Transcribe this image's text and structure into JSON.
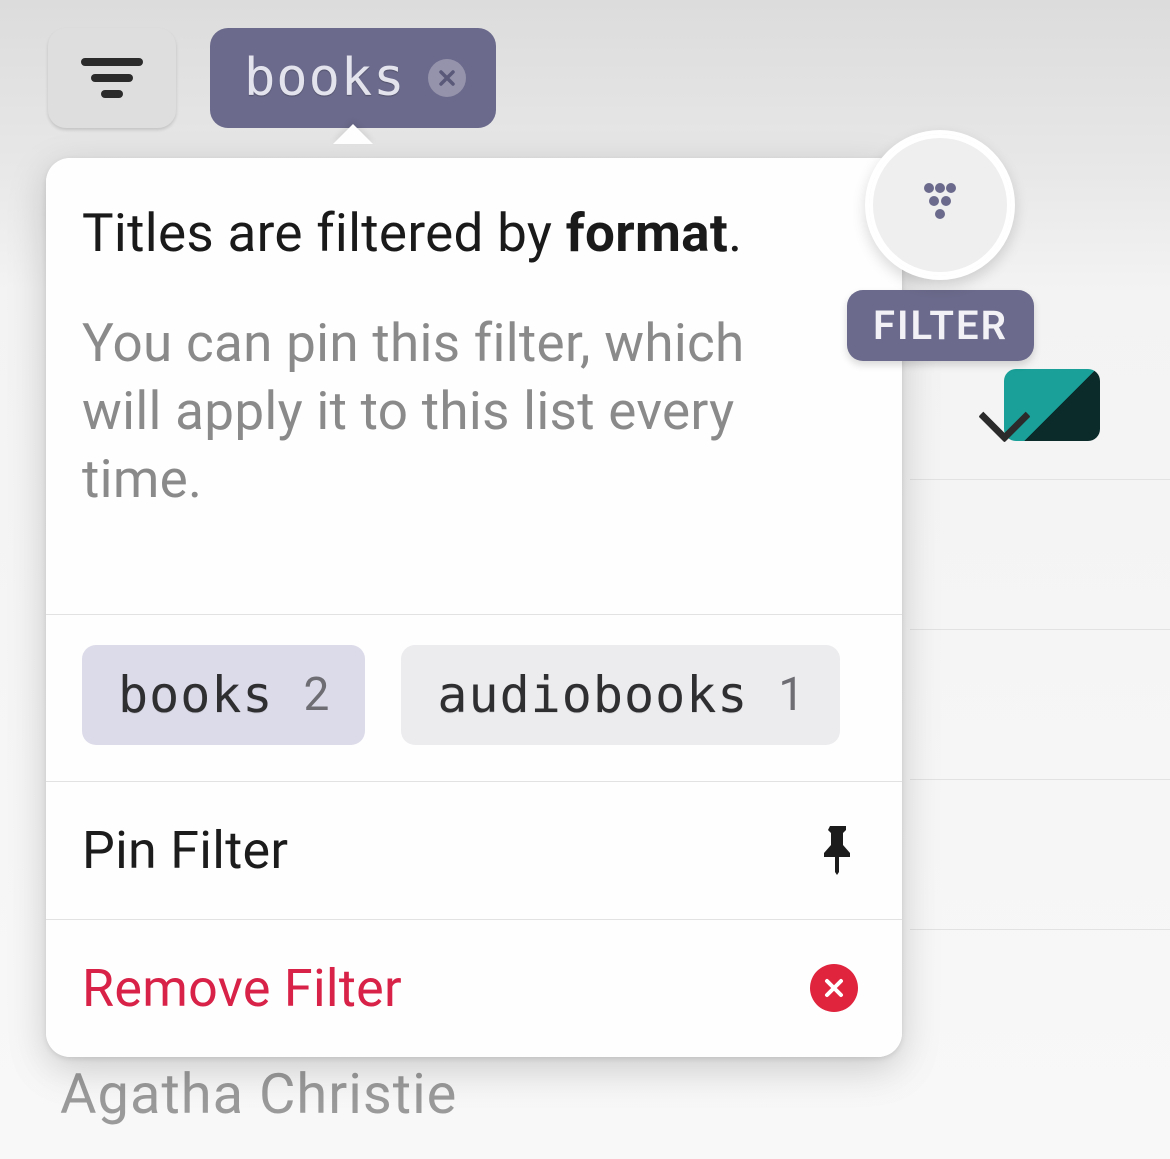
{
  "topbar": {
    "chip_label": "books"
  },
  "popover": {
    "heading_prefix": "Titles are filtered by ",
    "heading_bold": "format",
    "heading_suffix": ".",
    "subtext": "You can pin this filter, which will apply it to this list every time.",
    "options": [
      {
        "label": "books",
        "count": "2",
        "selected": true
      },
      {
        "label": "audiobooks",
        "count": "1",
        "selected": false
      }
    ],
    "pin_label": "Pin Filter",
    "remove_label": "Remove Filter"
  },
  "callout": {
    "label": "FILTER"
  },
  "background": {
    "author_partial": "Agatha Christie"
  }
}
